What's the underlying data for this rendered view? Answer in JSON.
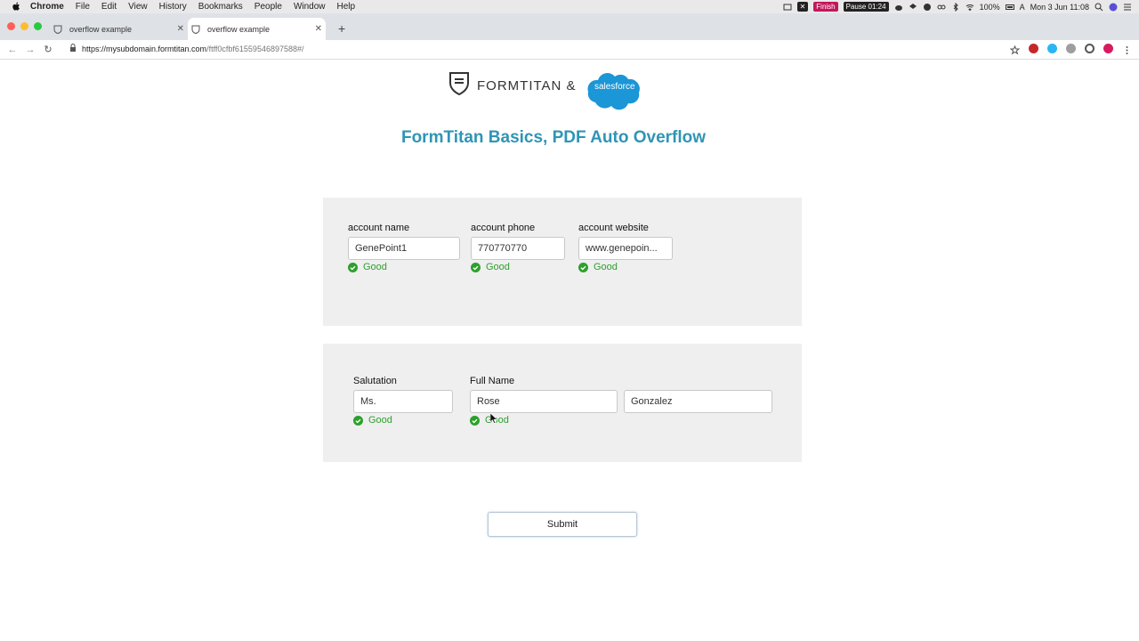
{
  "menubar": {
    "app": "Chrome",
    "items": [
      "File",
      "Edit",
      "View",
      "History",
      "Bookmarks",
      "People",
      "Window",
      "Help"
    ],
    "finish_badge": "Finish",
    "pause_badge": "Pause 01:24",
    "battery": "100%",
    "input_source": "A",
    "clock": "Mon 3 Jun  11:08"
  },
  "tabs": [
    {
      "title": "overflow example",
      "active": false
    },
    {
      "title": "overflow example",
      "active": true
    }
  ],
  "address": {
    "host": "https://mysubdomain.formtitan.com",
    "path": "/ftff0cfbf61559546897588#/"
  },
  "header": {
    "brand_text": "FORMTITAN &",
    "partner_text": "salesforce",
    "title": "FormTitan Basics, PDF Auto Overflow"
  },
  "section1": {
    "fields": [
      {
        "label": "account name",
        "value": "GenePoint1",
        "status": "Good"
      },
      {
        "label": "account phone",
        "value": "770770770",
        "status": "Good"
      },
      {
        "label": "account website",
        "value": "www.genepoin...",
        "status": "Good"
      }
    ]
  },
  "section2": {
    "salutation": {
      "label": "Salutation",
      "value": "Ms.",
      "status": "Good"
    },
    "fullname": {
      "label": "Full Name",
      "first": "Rose",
      "last": "Gonzalez",
      "status": "Good"
    }
  },
  "submit_label": "Submit",
  "colors": {
    "title": "#2f95b5",
    "good": "#2ca02c",
    "panel": "#efefef",
    "salesforce": "#1b96d6"
  }
}
